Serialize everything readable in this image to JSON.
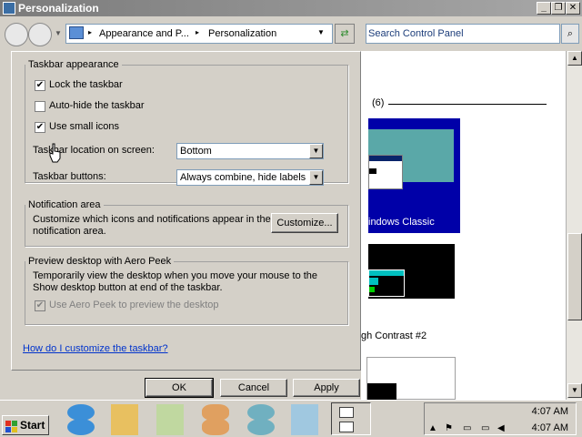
{
  "window": {
    "title": "Personalization"
  },
  "address": {
    "crumbs": [
      "Appearance and P...",
      "Personalization"
    ],
    "search_placeholder": "Search Control Panel"
  },
  "dialog": {
    "taskbar_appearance": {
      "title": "Taskbar appearance",
      "lock_label": "Lock the taskbar",
      "lock_checked": true,
      "autohide_label": "Auto-hide the taskbar",
      "autohide_checked": false,
      "small_icons_label": "Use small icons",
      "small_icons_checked": true,
      "location_label": "Taskbar location on screen:",
      "location_value": "Bottom",
      "buttons_label": "Taskbar buttons:",
      "buttons_value": "Always combine, hide labels"
    },
    "notification": {
      "title": "Notification area",
      "description": "Customize which icons and notifications appear in the notification area.",
      "customize_label": "Customize..."
    },
    "aero_peek": {
      "title": "Preview desktop with Aero Peek",
      "description": "Temporarily view the desktop when you move your mouse to the Show desktop button at end of the taskbar.",
      "checkbox_label": "Use Aero Peek to preview the desktop",
      "checkbox_checked": true
    },
    "help_link": "How do I customize the taskbar?",
    "ok_label": "OK",
    "cancel_label": "Cancel",
    "apply_label": "Apply"
  },
  "themes": {
    "count_label": "(6)",
    "classic_label": "indows Classic",
    "contrast_label": "gh Contrast #2"
  },
  "taskbar": {
    "start_label": "Start",
    "clock_top": "4:07 AM",
    "clock_bottom": "4:07 AM"
  },
  "colors": {
    "link": "#0033cc",
    "classic_theme_bg": "#0000a8",
    "classic_theme_desktop": "#5aa8a8"
  }
}
